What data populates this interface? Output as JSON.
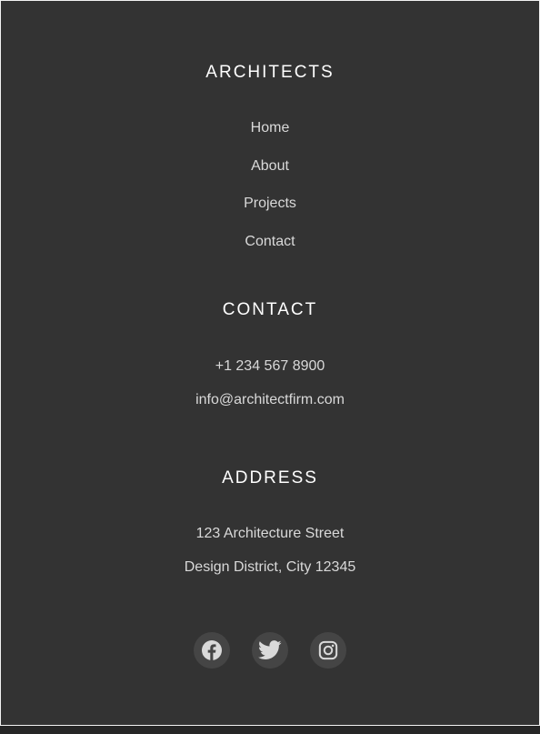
{
  "sections": {
    "architects": {
      "heading": "ARCHITECTS",
      "links": [
        "Home",
        "About",
        "Projects",
        "Contact"
      ]
    },
    "contact": {
      "heading": "CONTACT",
      "phone": "+1 234 567 8900",
      "email": "info@architectfirm.com"
    },
    "address": {
      "heading": "ADDRESS",
      "line1": "123 Architecture Street",
      "line2": "Design District, City 12345"
    }
  },
  "social": {
    "icons": [
      "facebook-icon",
      "twitter-icon",
      "instagram-icon"
    ]
  },
  "colors": {
    "background": "#333333",
    "heading": "#ffffff",
    "text": "#d9d9d9",
    "icon_circle": "#454545",
    "icon_glyph": "#d9d9d9"
  }
}
